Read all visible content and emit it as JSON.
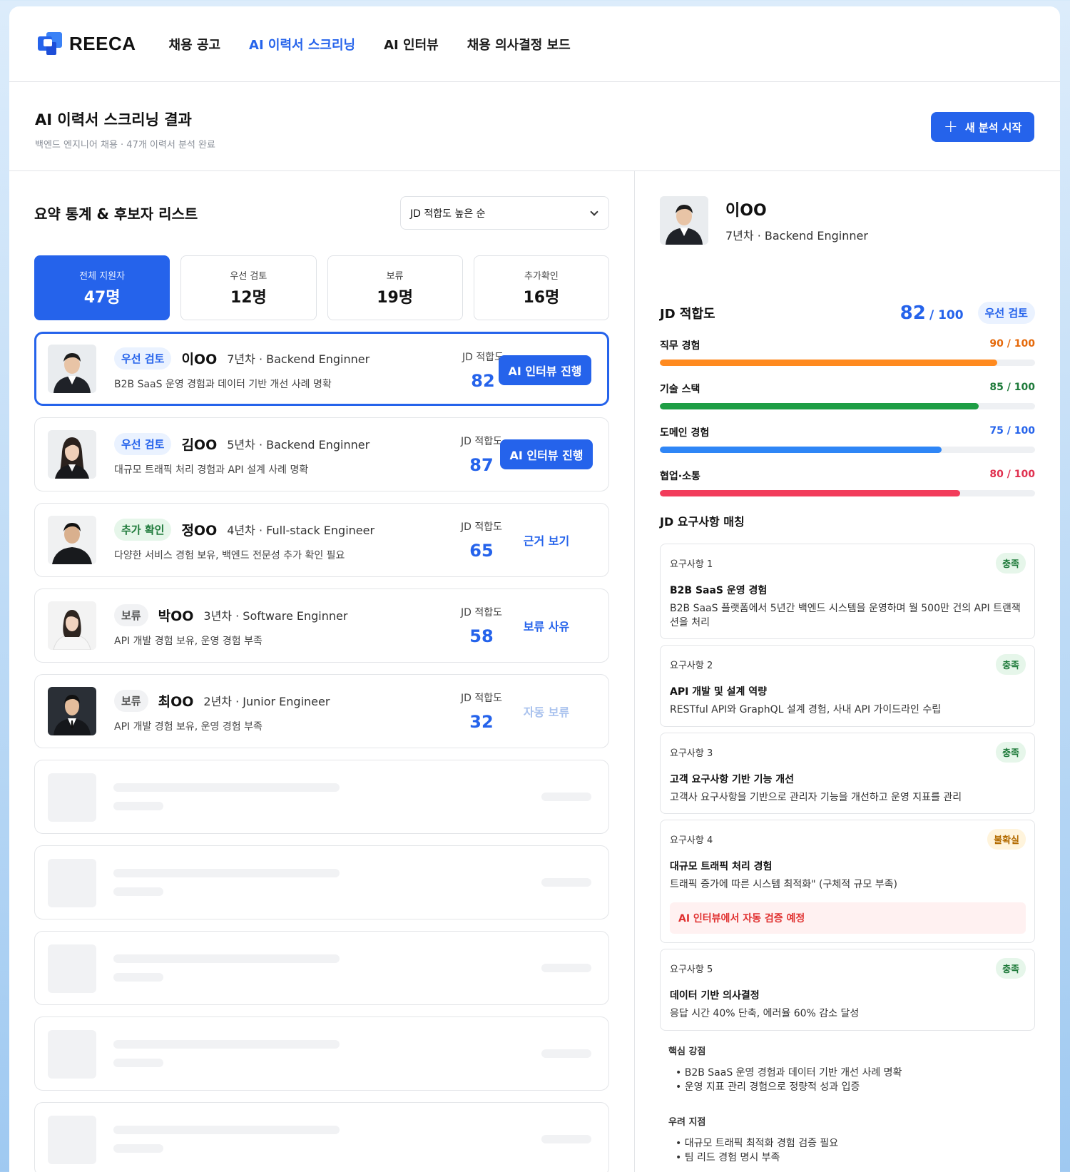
{
  "nav": {
    "logo": "REECA",
    "items": [
      "채용 공고",
      "AI 이력서 스크리닝",
      "AI 인터뷰",
      "채용 의사결정 보드"
    ],
    "active_index": 1
  },
  "header": {
    "title": "AI 이력서 스크리닝 결과",
    "subtitle": "백엔드 엔지니어 채용 · 47개 이력서 분석 완료",
    "new_button": "새 분석 시작"
  },
  "left": {
    "title": "요약 통계 & 후보자 리스트",
    "sort_value": "JD 적합도 높은 순",
    "stats": [
      {
        "label": "전체 지원자",
        "value": "47명"
      },
      {
        "label": "우선 검토",
        "value": "12명"
      },
      {
        "label": "보류",
        "value": "19명"
      },
      {
        "label": "추가확인",
        "value": "16명"
      }
    ],
    "candidates": [
      {
        "badge": "우선 검토",
        "name": "이OO",
        "meta": "7년차 · Backend Enginner",
        "desc": "B2B SaaS 운영 경험과 데이터 기반 개선 사례 명확",
        "jd_label": "JD 적합도",
        "jd": "82",
        "action": "AI 인터뷰 진행"
      },
      {
        "badge": "우선 검토",
        "name": "김OO",
        "meta": "5년차 · Backend Enginner",
        "desc": "대규모 트래픽 처리 경험과 API 설계 사례 명확",
        "jd_label": "JD 적합도",
        "jd": "87",
        "action": "AI 인터뷰 진행"
      },
      {
        "badge": "추가 확인",
        "name": "정OO",
        "meta": "4년차 · Full-stack Engineer",
        "desc": "다양한 서비스 경험 보유, 백엔드 전문성 추가 확인 필요",
        "jd_label": "JD 적합도",
        "jd": "65",
        "action": "근거 보기"
      },
      {
        "badge": "보류",
        "name": "박OO",
        "meta": "3년차 · Software Enginner",
        "desc": "API 개발 경험 보유, 운영 경험 부족",
        "jd_label": "JD 적합도",
        "jd": "58",
        "action": "보류 사유"
      },
      {
        "badge": "보류",
        "name": "최OO",
        "meta": "2년차 · Junior Engineer",
        "desc": "API 개발 경험 보유, 운영 경험 부족",
        "jd_label": "JD 적합도",
        "jd": "32",
        "action": "자동 보류"
      }
    ]
  },
  "right": {
    "name": "이OO",
    "meta": "7년차 · Backend Enginner",
    "jd_title": "JD 적합도",
    "score": "82",
    "score_max": "/ 100",
    "status_badge": "우선 검토",
    "bars": [
      {
        "label": "직무 경험",
        "text": "90 / 100",
        "value": 90,
        "color": "#ff8a1f",
        "text_color": "#e5690a"
      },
      {
        "label": "기술 스택",
        "text": "85 / 100",
        "value": 85,
        "color": "#1e9e45",
        "text_color": "#1e7a3a"
      },
      {
        "label": "도메인 경험",
        "text": "75 / 100",
        "value": 75,
        "color": "#2f86f6",
        "text_color": "#2563eb"
      },
      {
        "label": "협업·소통",
        "text": "80 / 100",
        "value": 80,
        "color": "#f23c5b",
        "text_color": "#e0304f"
      }
    ],
    "req_title": "JD 요구사항 매칭",
    "requirements": [
      {
        "num": "요구사항 1",
        "badge": "충족",
        "title": "B2B SaaS 운영 경험",
        "desc": "B2B SaaS 플랫폼에서 5년간 백엔드 시스템을 운영하며 월 500만 건의 API 트랜잭션을 처리"
      },
      {
        "num": "요구사항 2",
        "badge": "충족",
        "title": "API 개발 및 설계 역량",
        "desc": "RESTful API와 GraphQL 설계 경험, 사내 API 가이드라인 수립"
      },
      {
        "num": "요구사항 3",
        "badge": "충족",
        "title": "고객 요구사항 기반 기능 개선",
        "desc": "고객사 요구사항을 기반으로 관리자 기능을 개선하고 운영 지표를 관리"
      },
      {
        "num": "요구사항 4",
        "badge": "불확실",
        "title": "대규모 트래픽 처리 경험",
        "desc": "트래픽 증가에 따른 시스템 최적화\" (구체적 규모 부족)",
        "alert": "AI 인터뷰에서 자동 검증 예정"
      },
      {
        "num": "요구사항 5",
        "badge": "충족",
        "title": "데이터 기반 의사결정",
        "desc": "응답 시간 40% 단축, 에러율 60% 감소 달성"
      }
    ],
    "strengths_title": "핵심 강점",
    "strengths": [
      "B2B SaaS 운영 경험과 데이터 기반 개선 사례 명확",
      "운영 지표 관리 경험으로 정량적 성과 입증"
    ],
    "concerns_title": "우려 지점",
    "concerns": [
      "대규모 트래픽 최적화 경험 검증 필요",
      "팀 리드 경험 명시 부족"
    ]
  }
}
